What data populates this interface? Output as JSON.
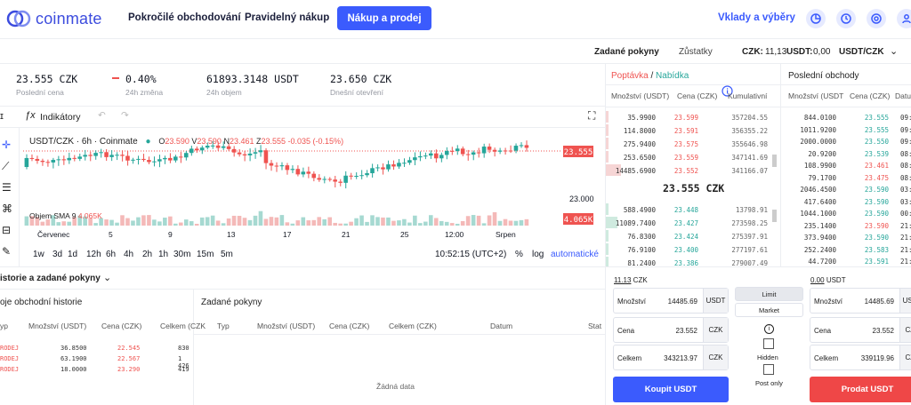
{
  "header": {
    "logo_text": "coinmate",
    "nav": [
      "Pokročilé obchodování",
      "Pravidelný nákup"
    ],
    "buy_sell": "Nákup a prodej",
    "deposits": "Vklady a výběry",
    "icons": [
      "pie-chart-icon",
      "history-icon",
      "support-icon",
      "user-icon"
    ]
  },
  "subheader": {
    "orders": "Zadané pokyny",
    "balances": "Zůstatky",
    "czk_label": "CZK:",
    "czk_value": "11,13",
    "usdt_label": "USDT:",
    "usdt_value": "0,00",
    "pair": "USDT/CZK"
  },
  "ticker": [
    {
      "value": "23.555 CZK",
      "label": "Poslední cena"
    },
    {
      "value": "0.40%",
      "label": "24h změna"
    },
    {
      "value": "61893.3148 USDT",
      "label": "24h objem"
    },
    {
      "value": "23.650 CZK",
      "label": "Dnešní otevření"
    }
  ],
  "chart_toolbar": {
    "indicators": "Indikátory"
  },
  "chart_legend": {
    "symbol": "USDT/CZK · 6h · Coinmate",
    "o_label": "O",
    "o": "23.590",
    "v_label": "V",
    "v": "23.590",
    "n_label": "N",
    "n": "23.461",
    "z_label": "Z",
    "z": "23.555",
    "chg": "-0.035 (-0.15%)",
    "volume_label": "Objem SMA 9",
    "volume_value": "4.065K"
  },
  "chart_data": {
    "type": "candlestick",
    "price_ticks": [
      "23.000"
    ],
    "last_price_label": "23.555",
    "volume_label": "4.065K",
    "x_ticks": [
      "Červenec",
      "5",
      "9",
      "13",
      "17",
      "21",
      "25",
      "12:00",
      "Srpen"
    ],
    "colors": {
      "up": "#26a69a",
      "down": "#ef5350"
    }
  },
  "timeframes": [
    "1w",
    "3d",
    "1d",
    "12h",
    "6h",
    "4h",
    "2h",
    "1h",
    "30m",
    "15m",
    "5m"
  ],
  "chart_status": {
    "time": "10:52:15 (UTC+2)",
    "pct": "%",
    "log": "log",
    "auto": "automatické"
  },
  "panels": {
    "title": "istorie a zadané pokyny",
    "history_title": "oje obchodní historie",
    "history_cols": [
      "yp",
      "Množství (USDT)",
      "Cena (CZK)",
      "Celkem (CZK"
    ],
    "history_rows": [
      {
        "type": "RODEJ",
        "qty": "36.8500",
        "price": "22.545",
        "total": "830"
      },
      {
        "type": "RODEJ",
        "qty": "63.1900",
        "price": "22.567",
        "total": "1 426"
      },
      {
        "type": "RODEJ",
        "qty": "18.0000",
        "price": "23.290",
        "total": "419"
      }
    ],
    "orders_title": "Zadané pokyny",
    "orders_cols": [
      "Typ",
      "Množství (USDT)",
      "Cena (CZK)",
      "Celkem (CZK)",
      "Datum",
      "Stat"
    ],
    "no_data": "Žádná data"
  },
  "orderbook": {
    "title_bid": "Poptávka",
    "title_sep": "/",
    "title_ask": "Nabídka",
    "cols": [
      "Množství (USDT)",
      "Cena (CZK)",
      "Kumulativní"
    ],
    "asks": [
      {
        "qty": "35.9900",
        "price": "23.599",
        "cum": "357204.55"
      },
      {
        "qty": "114.8000",
        "price": "23.591",
        "cum": "356355.22"
      },
      {
        "qty": "275.9400",
        "price": "23.575",
        "cum": "355646.98"
      },
      {
        "qty": "253.6500",
        "price": "23.559",
        "cum": "347141.69"
      },
      {
        "qty": "14485.6900",
        "price": "23.552",
        "cum": "341166.07"
      }
    ],
    "mid": "23.555 CZK",
    "bids": [
      {
        "qty": "588.4900",
        "price": "23.448",
        "cum": "13798.91"
      },
      {
        "qty": "11089.7400",
        "price": "23.427",
        "cum": "273598.25"
      },
      {
        "qty": "76.8300",
        "price": "23.424",
        "cum": "275397.91"
      },
      {
        "qty": "76.9100",
        "price": "23.400",
        "cum": "277197.61"
      },
      {
        "qty": "81.2400",
        "price": "23.386",
        "cum": "279007.49"
      }
    ]
  },
  "trades": {
    "title": "Poslední obchody",
    "cols": [
      "Množství (USDT",
      "Cena (CZK)",
      "Datu"
    ],
    "rows": [
      {
        "qty": "844.0100",
        "price": "23.555",
        "c": "g",
        "t": "09:"
      },
      {
        "qty": "1011.9200",
        "price": "23.555",
        "c": "g",
        "t": "09:"
      },
      {
        "qty": "2000.0000",
        "price": "23.550",
        "c": "g",
        "t": "09:"
      },
      {
        "qty": "20.9200",
        "price": "23.539",
        "c": "g",
        "t": "08:"
      },
      {
        "qty": "108.9900",
        "price": "23.461",
        "c": "r",
        "t": "08:"
      },
      {
        "qty": "79.1700",
        "price": "23.475",
        "c": "r",
        "t": "08:"
      },
      {
        "qty": "2046.4500",
        "price": "23.590",
        "c": "g",
        "t": "03:"
      },
      {
        "qty": "417.6400",
        "price": "23.590",
        "c": "g",
        "t": "03:"
      },
      {
        "qty": "1044.1000",
        "price": "23.590",
        "c": "g",
        "t": "00:"
      },
      {
        "qty": "235.1400",
        "price": "23.590",
        "c": "r",
        "t": "21:"
      },
      {
        "qty": "373.9400",
        "price": "23.590",
        "c": "g",
        "t": "21:"
      },
      {
        "qty": "252.2400",
        "price": "23.583",
        "c": "g",
        "t": "21:"
      },
      {
        "qty": "44.7200",
        "price": "23.591",
        "c": "g",
        "t": "21:"
      }
    ]
  },
  "buy_form": {
    "balance": "11.13",
    "balance_unit": "CZK",
    "qty_label": "Množství",
    "qty": "14485.69",
    "qty_unit": "USDT",
    "price_label": "Cena",
    "price": "23.552",
    "price_unit": "CZK",
    "total_label": "Celkem",
    "total": "343213.97",
    "total_unit": "CZK",
    "button": "Koupit USDT"
  },
  "sell_form": {
    "balance": "0.00",
    "balance_unit": "USDT",
    "qty_label": "Množství",
    "qty": "14485.69",
    "qty_unit": "USDT",
    "price_label": "Cena",
    "price": "23.552",
    "price_unit": "CZK",
    "total_label": "Celkem",
    "total": "339119.96",
    "total_unit": "CZK",
    "button": "Prodat USDT"
  },
  "order_type": {
    "limit": "Limit",
    "market": "Market",
    "info": "i",
    "hidden": "Hidden",
    "post_only": "Post only"
  }
}
